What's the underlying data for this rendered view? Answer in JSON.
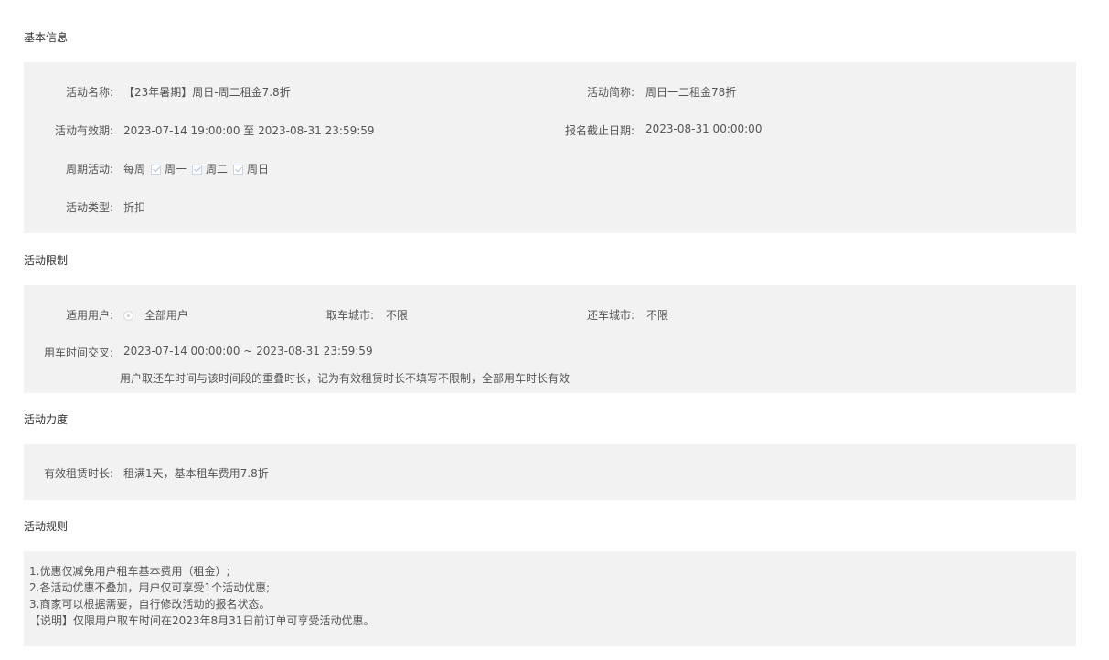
{
  "sections": {
    "basic": "基本信息",
    "limits": "活动限制",
    "strength": "活动力度",
    "rules": "活动规则"
  },
  "basic": {
    "name_label": "活动名称:",
    "name_value": "【23年暑期】周日-周二租金7.8折",
    "short_label": "活动简称:",
    "short_value": "周日一二租金78折",
    "period_label": "活动有效期:",
    "period_value": "2023-07-14 19:00:00 至 2023-08-31 23:59:59",
    "deadline_label": "报名截止日期:",
    "deadline_value": "2023-08-31 00:00:00",
    "cycle_label": "周期活动:",
    "cycle_prefix": "每周",
    "cycle_days": [
      "周一",
      "周二",
      "周日"
    ],
    "type_label": "活动类型:",
    "type_value": "折扣"
  },
  "limits": {
    "user_label": "适用用户:",
    "user_value": "全部用户",
    "pickup_label": "取车城市:",
    "pickup_value": "不限",
    "return_label": "还车城市:",
    "return_value": "不限",
    "overlap_label": "用车时间交叉:",
    "overlap_value": "2023-07-14 00:00:00 ~ 2023-08-31 23:59:59",
    "overlap_note": "用户取还车时间与该时间段的重叠时长，记为有效租赁时长不填写不限制，全部用车时长有效"
  },
  "strength": {
    "label": "有效租赁时长:",
    "value": "租满1天，基本租车费用7.8折"
  },
  "rules": {
    "lines": [
      "1.优惠仅减免用户租车基本费用（租金）;",
      "2.各活动优惠不叠加，用户仅可享受1个活动优惠;",
      "3.商家可以根据需要，自行修改活动的报名状态。",
      "【说明】仅限用户取车时间在2023年8月31日前订单可享受活动优惠。"
    ]
  }
}
